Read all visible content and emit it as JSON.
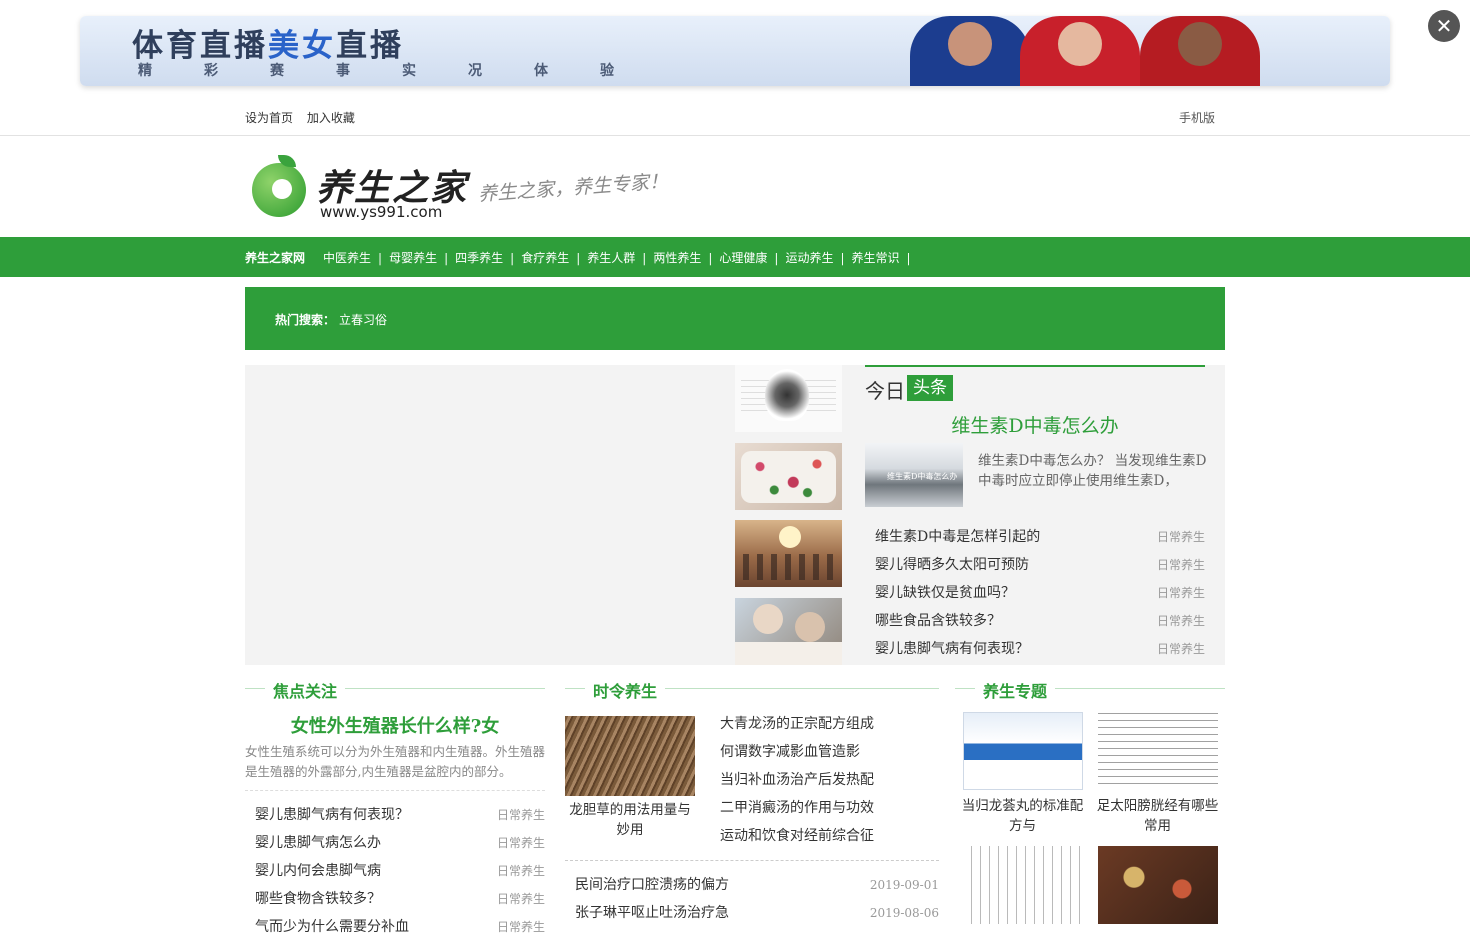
{
  "banner": {
    "title_a": "体育直播",
    "title_b": "美女",
    "title_c": "直播",
    "subtitle": "精彩赛事实况体验",
    "close_glyph": "✕"
  },
  "topbar": {
    "set_home": "设为首页",
    "add_favorite": "加入收藏",
    "mobile": "手机版"
  },
  "logo": {
    "name": "养生之家",
    "url": "www.ys991.com",
    "slogan": "养生之家，养生专家！"
  },
  "nav": {
    "home": "养生之家网",
    "items": [
      "中医养生",
      "母婴养生",
      "四季养生",
      "食疗养生",
      "养生人群",
      "两性养生",
      "心理健康",
      "运动养生",
      "养生常识"
    ],
    "separator": "|"
  },
  "hot_search": {
    "label": "热门搜索：",
    "keyword": "立春习俗"
  },
  "slider": {
    "thumb1_caption": ""
  },
  "today": {
    "word": "今日",
    "tag": "头条",
    "headline": "维生素D中毒怎么办",
    "image_caption": "维生素D中毒怎么办",
    "summary": "维生素D中毒怎么办？ 当发现维生素D中毒时应立即停止使用维生素D，",
    "list": [
      {
        "title": "维生素D中毒是怎样引起的",
        "cat": "日常养生"
      },
      {
        "title": "婴儿得晒多久太阳可预防",
        "cat": "日常养生"
      },
      {
        "title": "婴儿缺铁仅是贫血吗？",
        "cat": "日常养生"
      },
      {
        "title": "哪些食品含铁较多？",
        "cat": "日常养生"
      },
      {
        "title": "婴儿患脚气病有何表现？",
        "cat": "日常养生"
      }
    ]
  },
  "focus": {
    "section": "焦点关注",
    "headline": "女性外生殖器长什么样?女",
    "summary": "女性生殖系统可以分为外生殖器和内生殖器。外生殖器是生殖器的外露部分,内生殖器是盆腔内的部分。",
    "list": [
      {
        "title": "婴儿患脚气病有何表现？",
        "cat": "日常养生"
      },
      {
        "title": "婴儿患脚气病怎么办",
        "cat": "日常养生"
      },
      {
        "title": "婴儿内何会患脚气病",
        "cat": "日常养生"
      },
      {
        "title": "哪些食物含铁较多？",
        "cat": "日常养生"
      },
      {
        "title": "气而少为什么需要分补血",
        "cat": "日常养生"
      }
    ]
  },
  "season": {
    "section": "时令养生",
    "image_caption": "龙胆草的用法用量与妙用",
    "side_list": [
      "大青龙汤的正宗配方组成",
      "何谓数字减影血管造影",
      "当归补血汤治产后发热配",
      "二甲消癜汤的作用与功效",
      "运动和饮食对经前综合征"
    ],
    "dated_list": [
      {
        "title": "民间治疗口腔溃疡的偏方",
        "date": "2019-09-01"
      },
      {
        "title": "张子琳平呕止吐汤治疗急",
        "date": "2019-08-06"
      }
    ]
  },
  "topic": {
    "section": "养生专题",
    "cards": [
      {
        "caption": "当归龙荟丸的标准配方与"
      },
      {
        "caption": "足太阳膀胱经有哪些常用"
      },
      {
        "caption": ""
      },
      {
        "caption": ""
      }
    ],
    "box_label": "当归龙荟丸"
  }
}
